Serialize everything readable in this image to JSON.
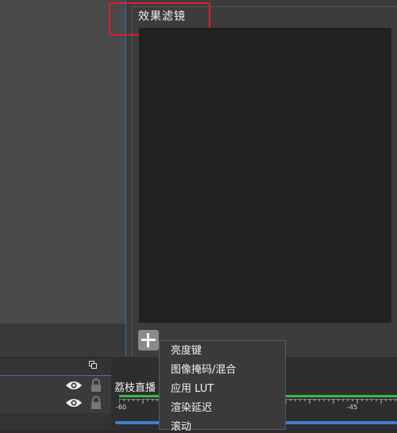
{
  "filter_dialog": {
    "title": "效果滤镜",
    "add_icon": "plus-icon"
  },
  "context_menu": {
    "items": [
      "亮度键",
      "图像掩码/混合",
      "应用 LUT",
      "渲染延迟",
      "滚动"
    ]
  },
  "sources": {
    "visibility_icon": "eye-icon",
    "lock_icon": "lock-icon",
    "dock_icon": "dock-undock-icon"
  },
  "mixer": {
    "source_label": "荔枝直播",
    "tick_labels": [
      "-60",
      "-45"
    ]
  },
  "colors": {
    "highlight_border": "#e02020",
    "dialog_border": "#2f6fb0",
    "meter_green": "#3fb83f",
    "volume_blue": "#3c7ed0"
  }
}
